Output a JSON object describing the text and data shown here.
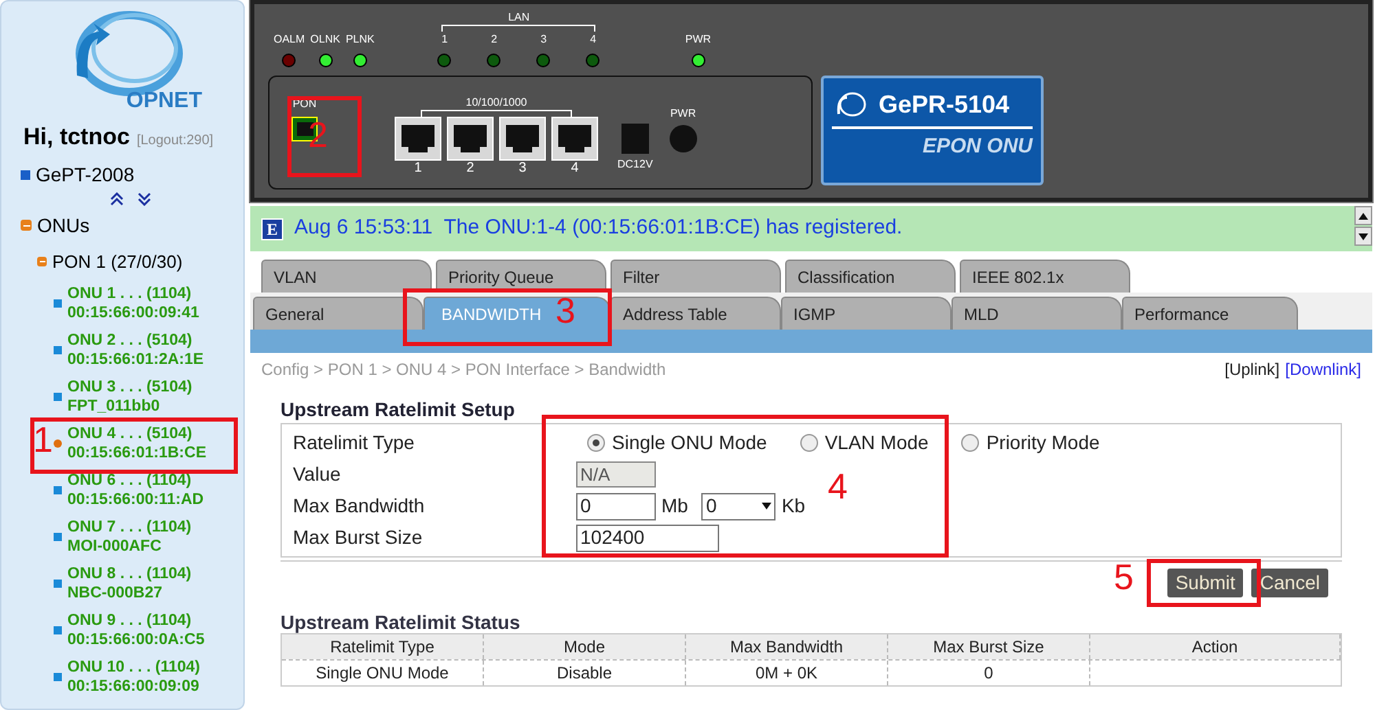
{
  "sidebar": {
    "brand": "OPNET",
    "greeting": "Hi, tctnoc",
    "logout": "[Logout:290]",
    "device": "GePT-2008",
    "tree": [
      {
        "label": "ONUs",
        "expanded": true,
        "children": [
          {
            "label": "PON 1 (27/0/30)",
            "expanded": true,
            "children": [
              {
                "title": "ONU 1 . . . (1104)",
                "detail": "00:15:66:00:09:41",
                "selected": false
              },
              {
                "title": "ONU 2 . . . (5104)",
                "detail": "00:15:66:01:2A:1E",
                "selected": false
              },
              {
                "title": "ONU 3 . . . (5104)",
                "detail": "FPT_011bb0",
                "selected": false
              },
              {
                "title": "ONU 4 . . . (5104)",
                "detail": "00:15:66:01:1B:CE",
                "selected": true
              },
              {
                "title": "ONU 6 . . . (1104)",
                "detail": "00:15:66:00:11:AD",
                "selected": false
              },
              {
                "title": "ONU 7 . . . (1104)",
                "detail": "MOI-000AFC",
                "selected": false
              },
              {
                "title": "ONU 8 . . . (1104)",
                "detail": "NBC-000B27",
                "selected": false
              },
              {
                "title": "ONU 9 . . . (1104)",
                "detail": "00:15:66:00:0A:C5",
                "selected": false
              },
              {
                "title": "ONU 10 . . . (1104)",
                "detail": "00:15:66:00:09:09",
                "selected": false
              }
            ]
          }
        ]
      }
    ]
  },
  "device_panel": {
    "status_leds": [
      {
        "label": "OALM",
        "on": false,
        "kind": "alarm"
      },
      {
        "label": "OLNK",
        "on": true,
        "kind": "link"
      },
      {
        "label": "PLNK",
        "on": true,
        "kind": "link"
      }
    ],
    "lan_label": "LAN",
    "lan_leds": [
      {
        "label": "1",
        "on": false
      },
      {
        "label": "2",
        "on": false
      },
      {
        "label": "3",
        "on": false
      },
      {
        "label": "4",
        "on": false
      }
    ],
    "pwr_led": {
      "label": "PWR",
      "on": true
    },
    "pon_label": "PON",
    "port_group_label": "10/100/1000",
    "ports": [
      "1",
      "2",
      "3",
      "4"
    ],
    "dc_label": "DC12V",
    "pwr_label": "PWR",
    "badge": {
      "model": "GePR-5104",
      "subtitle": "EPON ONU"
    }
  },
  "event": {
    "badge": "E",
    "text": "Aug 6 15:53:11  The ONU:1-4 (00:15:66:01:1B:CE) has registered."
  },
  "tabs": [
    [
      {
        "label": "VLAN",
        "selected": false
      },
      {
        "label": "Priority Queue",
        "selected": false
      },
      {
        "label": "Filter",
        "selected": false
      },
      {
        "label": "Classification",
        "selected": false
      },
      {
        "label": "IEEE 802.1x",
        "selected": false
      }
    ],
    [
      {
        "label": "General",
        "selected": false
      },
      {
        "label": "BANDWIDTH",
        "selected": true
      },
      {
        "label": "Address Table",
        "selected": false
      },
      {
        "label": "IGMP",
        "selected": false
      },
      {
        "label": "MLD",
        "selected": false
      },
      {
        "label": "Performance",
        "selected": false
      }
    ]
  ],
  "breadcrumb": "Config > PON 1 > ONU 4 > PON Interface > Bandwidth",
  "direction_links": [
    {
      "label": "[Uplink]",
      "selected": true
    },
    {
      "label": "[Downlink]",
      "selected": false
    }
  ],
  "setup": {
    "title": "Upstream Ratelimit Setup",
    "type_label": "Ratelimit Type",
    "modes": [
      {
        "label": "Single ONU Mode",
        "selected": true
      },
      {
        "label": "VLAN Mode",
        "selected": false
      },
      {
        "label": "Priority Mode",
        "selected": false
      }
    ],
    "value_label": "Value",
    "value": "N/A",
    "bandwidth_label": "Max Bandwidth",
    "mb_value": "0",
    "mb_unit": "Mb",
    "kb_value": "0",
    "kb_unit": "Kb",
    "burst_label": "Max Burst Size",
    "burst_value": "102400"
  },
  "buttons": [
    "Submit",
    "Cancel"
  ],
  "status": {
    "title": "Upstream Ratelimit Status",
    "columns": [
      "Ratelimit Type",
      "Mode",
      "Max Bandwidth",
      "Max Burst Size",
      "Action"
    ],
    "rows": [
      [
        "Single ONU Mode",
        "Disable",
        "0M + 0K",
        "0"
      ]
    ]
  },
  "callouts": [
    "1",
    "2",
    "3",
    "4",
    "5"
  ]
}
